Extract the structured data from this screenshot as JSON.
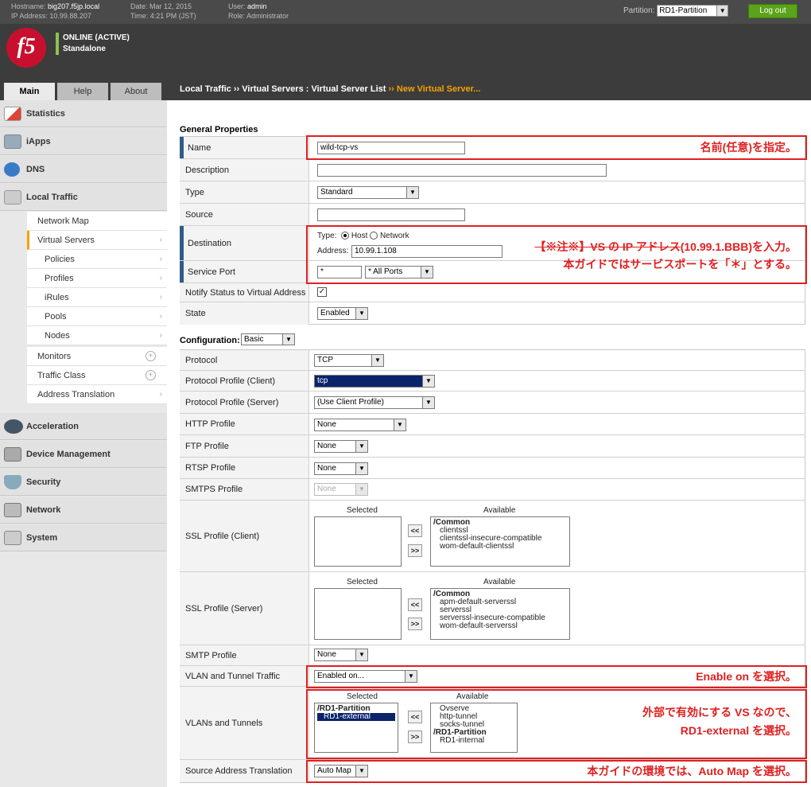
{
  "topbar": {
    "hostname_label": "Hostname:",
    "hostname": "big207.f5jp.local",
    "ip_label": "IP Address:",
    "ip": "10.99.88.207",
    "date_label": "Date:",
    "date": "Mar 12, 2015",
    "time_label": "Time:",
    "time": "4:21 PM (JST)",
    "user_label": "User:",
    "user": "admin",
    "role_label": "Role:",
    "role": "Administrator",
    "partition_label": "Partition:",
    "partition": "RD1-Partition",
    "logout": "Log out"
  },
  "header": {
    "status1": "ONLINE (ACTIVE)",
    "status2": "Standalone"
  },
  "tabs": [
    "Main",
    "Help",
    "About"
  ],
  "breadcrumb": {
    "p1": "Local Traffic",
    "sep1": "››",
    "p2": "Virtual Servers : Virtual Server List",
    "sep2": "››",
    "current": "New Virtual Server..."
  },
  "sidebar": {
    "statistics": "Statistics",
    "iapps": "iApps",
    "dns": "DNS",
    "local_traffic": "Local Traffic",
    "network_map": "Network Map",
    "virtual_servers": "Virtual Servers",
    "policies": "Policies",
    "profiles": "Profiles",
    "irules": "iRules",
    "pools": "Pools",
    "nodes": "Nodes",
    "monitors": "Monitors",
    "traffic_class": "Traffic Class",
    "address_translation": "Address Translation",
    "acceleration": "Acceleration",
    "device_management": "Device Management",
    "security": "Security",
    "network": "Network",
    "system": "System"
  },
  "general": {
    "title": "General Properties",
    "name_lbl": "Name",
    "name_val": "wild-tcp-vs",
    "desc_lbl": "Description",
    "type_lbl": "Type",
    "type_val": "Standard",
    "source_lbl": "Source",
    "dest_lbl": "Destination",
    "dest_type_lbl": "Type:",
    "dest_host": "Host",
    "dest_network": "Network",
    "dest_addr_lbl": "Address:",
    "dest_addr": "10.99.1.108",
    "port_lbl": "Service Port",
    "port_val": "*",
    "port_sel": "* All Ports",
    "notify_lbl": "Notify Status to Virtual Address",
    "notify_check": "✓",
    "state_lbl": "State",
    "state_val": "Enabled"
  },
  "config": {
    "title": "Configuration:",
    "mode": "Basic",
    "protocol_lbl": "Protocol",
    "protocol_val": "TCP",
    "ppc_lbl": "Protocol Profile (Client)",
    "ppc_val": "tcp",
    "pps_lbl": "Protocol Profile (Server)",
    "pps_val": "(Use Client Profile)",
    "http_lbl": "HTTP Profile",
    "http_val": "None",
    "ftp_lbl": "FTP Profile",
    "ftp_val": "None",
    "rtsp_lbl": "RTSP Profile",
    "rtsp_val": "None",
    "smtps_lbl": "SMTPS Profile",
    "smtps_val": "None",
    "selected": "Selected",
    "available": "Available",
    "move_left": "<<",
    "move_right": ">>",
    "sslc_lbl": "SSL Profile (Client)",
    "sslc_group": "/Common",
    "sslc_items": [
      "clientssl",
      "clientssl-insecure-compatible",
      "wom-default-clientssl"
    ],
    "ssls_lbl": "SSL Profile (Server)",
    "ssls_group": "/Common",
    "ssls_items": [
      "apm-default-serverssl",
      "serverssl",
      "serverssl-insecure-compatible",
      "wom-default-serverssl"
    ],
    "smtp_lbl": "SMTP Profile",
    "smtp_val": "None",
    "vlan_traffic_lbl": "VLAN and Tunnel Traffic",
    "vlan_traffic_val": "Enabled on...",
    "vlans_lbl": "VLANs and Tunnels",
    "vlans_sel_group": "/RD1-Partition",
    "vlans_sel_item": "RD1-external",
    "vlans_avail": [
      "Ovserve",
      "http-tunnel",
      "socks-tunnel"
    ],
    "vlans_avail_group": "/RD1-Partition",
    "vlans_avail_item": "RD1-internal",
    "snat_lbl": "Source Address Translation",
    "snat_val": "Auto Map"
  },
  "annotations": {
    "name": "名前(任意)を指定。",
    "dest_line1_strike": "【※注※】VS の IP アドレス",
    "dest_line1_rest": "(10.99.1.BBB)を入力。",
    "dest_line2": "本ガイドではサービスポートを「＊」とする。",
    "vlan_traffic": "Enable on を選択。",
    "vlans_line1": "外部で有効にする VS なので、",
    "vlans_line2": "RD1-external を選択。",
    "snat": "本ガイドの環境では、Auto Map を選択。",
    "color": "#e02020"
  }
}
